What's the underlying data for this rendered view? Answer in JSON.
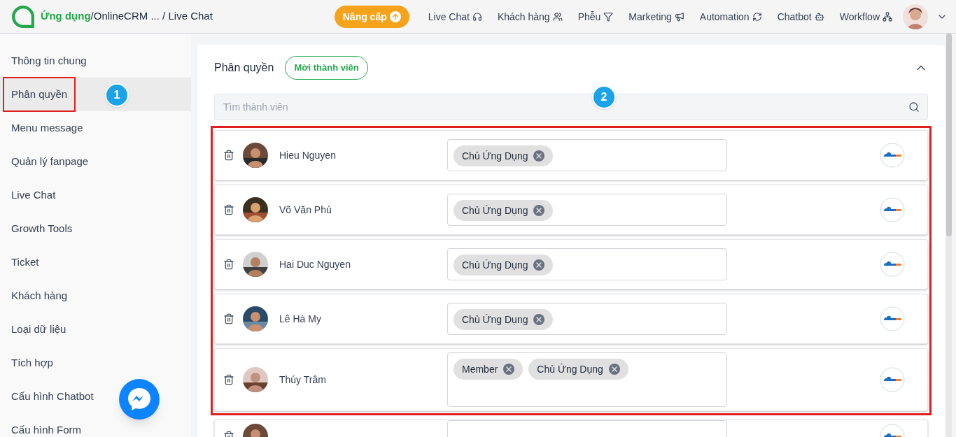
{
  "breadcrumb": {
    "app": "Ứng dụng",
    "path": "/OnlineCRM ...",
    "current": " / Live Chat"
  },
  "upgrade_button": "Nâng cấp",
  "nav": [
    {
      "label": "Live Chat",
      "kind": "headset"
    },
    {
      "label": "Khách hàng",
      "kind": "users"
    },
    {
      "label": "Phễu",
      "kind": "filter"
    },
    {
      "label": "Marketing",
      "kind": "megaphone"
    },
    {
      "label": "Automation",
      "kind": "sync"
    },
    {
      "label": "Chatbot",
      "kind": "bot"
    },
    {
      "label": "Workflow",
      "kind": "workflow"
    }
  ],
  "sidebar": {
    "items": [
      {
        "label": "Thông tin chung",
        "selected": false
      },
      {
        "label": "Phân quyền",
        "selected": true
      },
      {
        "label": "Menu message",
        "selected": false
      },
      {
        "label": "Quản lý fanpage",
        "selected": false
      },
      {
        "label": "Live Chat",
        "selected": false
      },
      {
        "label": "Growth Tools",
        "selected": false
      },
      {
        "label": "Ticket",
        "selected": false
      },
      {
        "label": "Khách hàng",
        "selected": false
      },
      {
        "label": "Loại dữ liệu",
        "selected": false
      },
      {
        "label": "Tích hợp",
        "selected": false
      },
      {
        "label": "Cấu hình Chatbot",
        "selected": false
      },
      {
        "label": "Cấu hình Form",
        "selected": false
      }
    ]
  },
  "panel": {
    "title": "Phân quyền",
    "invite_button": "Mời thành viên",
    "expanded": true,
    "search": {
      "placeholder": "Tìm thành viên"
    },
    "members": [
      {
        "name": "Hieu Nguyen",
        "roles": [
          "Chủ Ứng Dụng"
        ]
      },
      {
        "name": "Võ Văn Phú",
        "roles": [
          "Chủ Ứng Dụng"
        ]
      },
      {
        "name": "Hai Duc Nguyen",
        "roles": [
          "Chủ Ứng Dụng"
        ]
      },
      {
        "name": "Lê Hà My",
        "roles": [
          "Chủ Ứng Dụng"
        ]
      },
      {
        "name": "Thúy Trâm",
        "roles": [
          "Member",
          "Chủ Ứng Dụng"
        ]
      }
    ]
  },
  "annotations": [
    "1",
    "2"
  ]
}
